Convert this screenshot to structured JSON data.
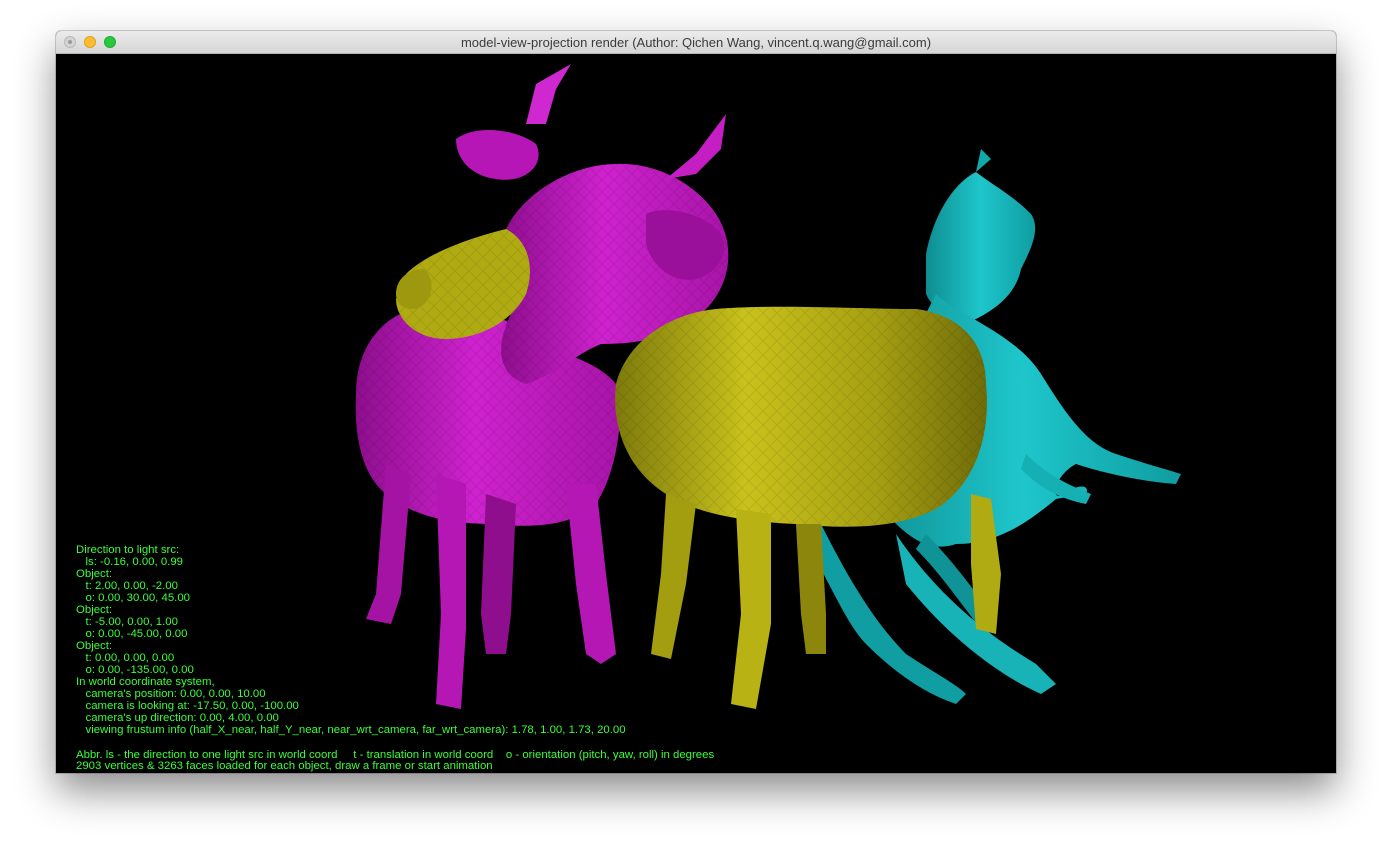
{
  "window": {
    "title": "model-view-projection render (Author: Qichen Wang, vincent.q.wang@gmail.com)"
  },
  "hud": {
    "lines": [
      "Direction to light src:",
      "   ls: -0.16, 0.00, 0.99",
      "Object:",
      "   t: 2.00, 0.00, -2.00",
      "   o: 0.00, 30.00, 45.00",
      "Object:",
      "   t: -5.00, 0.00, 1.00",
      "   o: 0.00, -45.00, 0.00",
      "Object:",
      "   t: 0.00, 0.00, 0.00",
      "   o: 0.00, -135.00, 0.00",
      "In world coordinate system,",
      "   camera's position: 0.00, 0.00, 10.00",
      "   camera is looking at: -17.50, 0.00, -100.00",
      "   camera's up direction: 0.00, 4.00, 0.00",
      "   viewing frustum info (half_X_near, half_Y_near, near_wrt_camera, far_wrt_camera): 1.78, 1.00, 1.73, 20.00"
    ],
    "abbr": "Abbr. ls - the direction to one light src in world coord     t - translation in world coord    o - orientation (pitch, yaw, roll) in degrees",
    "status": "2903 vertices & 3263 faces loaded for each object, draw a frame or start animation"
  },
  "colors": {
    "hud_text": "#39ff39",
    "cow_magenta": "#c21ac2",
    "cow_yellow": "#b8b214",
    "cow_cyan": "#14b8bd",
    "background": "#000000"
  }
}
